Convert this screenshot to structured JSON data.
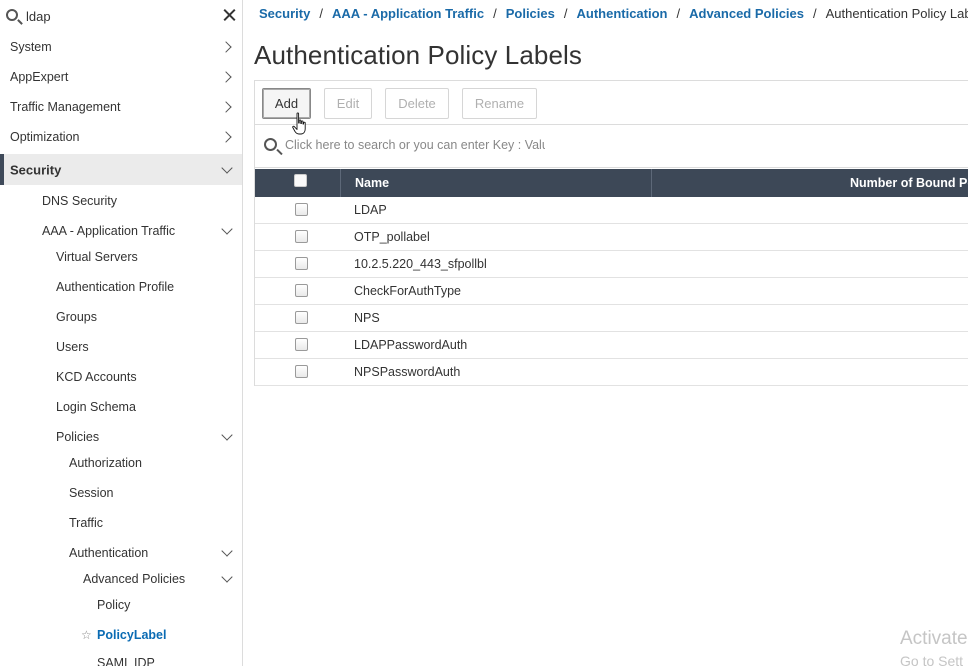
{
  "sidebar": {
    "search_value": "ldap",
    "items": [
      {
        "label": "System"
      },
      {
        "label": "AppExpert"
      },
      {
        "label": "Traffic Management"
      },
      {
        "label": "Optimization"
      },
      {
        "label": "Security"
      },
      {
        "label": "DNS Security"
      },
      {
        "label": "AAA - Application Traffic"
      },
      {
        "label": "Virtual Servers"
      },
      {
        "label": "Authentication Profile"
      },
      {
        "label": "Groups"
      },
      {
        "label": "Users"
      },
      {
        "label": "KCD Accounts"
      },
      {
        "label": "Login Schema"
      },
      {
        "label": "Policies"
      },
      {
        "label": "Authorization"
      },
      {
        "label": "Session"
      },
      {
        "label": "Traffic"
      },
      {
        "label": "Authentication"
      },
      {
        "label": "Advanced Policies"
      },
      {
        "label": "Policy"
      },
      {
        "label": "PolicyLabel"
      },
      {
        "label": "SAML IDP"
      }
    ]
  },
  "breadcrumb": {
    "items": [
      "Security",
      "AAA - Application Traffic",
      "Policies",
      "Authentication",
      "Advanced Policies"
    ],
    "separator": "/",
    "current": "Authentication Policy Labels"
  },
  "page": {
    "title": "Authentication Policy Labels"
  },
  "toolbar": {
    "add": "Add",
    "edit": "Edit",
    "delete": "Delete",
    "rename": "Rename"
  },
  "table": {
    "search_placeholder": "Click here to search or you can enter Key : Value",
    "columns": [
      "Name",
      "Number of Bound Po"
    ],
    "rows": [
      {
        "name": "LDAP"
      },
      {
        "name": "OTP_pollabel"
      },
      {
        "name": "10.2.5.220_443_sfpollbl"
      },
      {
        "name": "CheckForAuthType"
      },
      {
        "name": "NPS"
      },
      {
        "name": "LDAPPasswordAuth"
      },
      {
        "name": "NPSPasswordAuth"
      }
    ]
  },
  "watermark": {
    "line1": "Activate",
    "line2": "Go to Sett"
  },
  "colors": {
    "link": "#1a6aa8",
    "table_header": "#3d4857",
    "active_bar": "#3f4a5a",
    "selected_text": "#0a6bb3"
  }
}
